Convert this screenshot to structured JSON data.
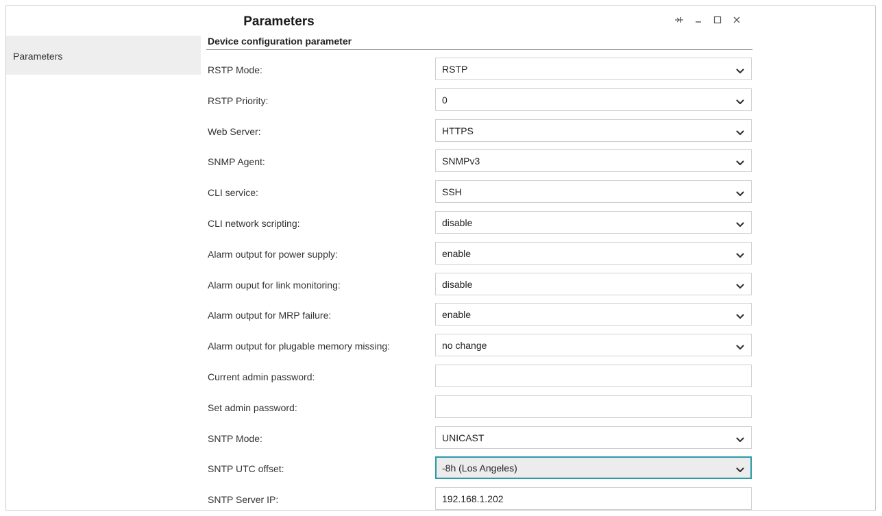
{
  "window": {
    "title": "Parameters",
    "controls": [
      "pin-icon",
      "minimize-icon",
      "maximize-icon",
      "close-icon"
    ]
  },
  "sidebar": {
    "items": [
      {
        "label": "Parameters"
      }
    ]
  },
  "section": {
    "title": "Device configuration parameter"
  },
  "fields": [
    {
      "label": "RSTP Mode:",
      "type": "select",
      "value": "RSTP"
    },
    {
      "label": "RSTP Priority:",
      "type": "select",
      "value": "0"
    },
    {
      "label": "Web Server:",
      "type": "select",
      "value": "HTTPS"
    },
    {
      "label": "SNMP Agent:",
      "type": "select",
      "value": "SNMPv3"
    },
    {
      "label": "CLI service:",
      "type": "select",
      "value": "SSH"
    },
    {
      "label": "CLI network scripting:",
      "type": "select",
      "value": "disable"
    },
    {
      "label": "Alarm output for power supply:",
      "type": "select",
      "value": "enable"
    },
    {
      "label": "Alarm ouput for link monitoring:",
      "type": "select",
      "value": "disable"
    },
    {
      "label": "Alarm output for MRP failure:",
      "type": "select",
      "value": "enable"
    },
    {
      "label": "Alarm output for plugable memory missing:",
      "type": "select",
      "value": "no change"
    },
    {
      "label": "Current admin password:",
      "type": "input",
      "value": ""
    },
    {
      "label": "Set admin password:",
      "type": "input",
      "value": ""
    },
    {
      "label": "SNTP Mode:",
      "type": "select",
      "value": "UNICAST"
    },
    {
      "label": "SNTP UTC offset:",
      "type": "select",
      "value": "-8h (Los Angeles)",
      "focused": true
    },
    {
      "label": "SNTP Server IP:",
      "type": "input",
      "value": "192.168.1.202"
    }
  ],
  "colors": {
    "focus_border": "#2a9aa3",
    "sidebar_bg": "#eeeeee",
    "field_border": "#cfcfcf"
  }
}
